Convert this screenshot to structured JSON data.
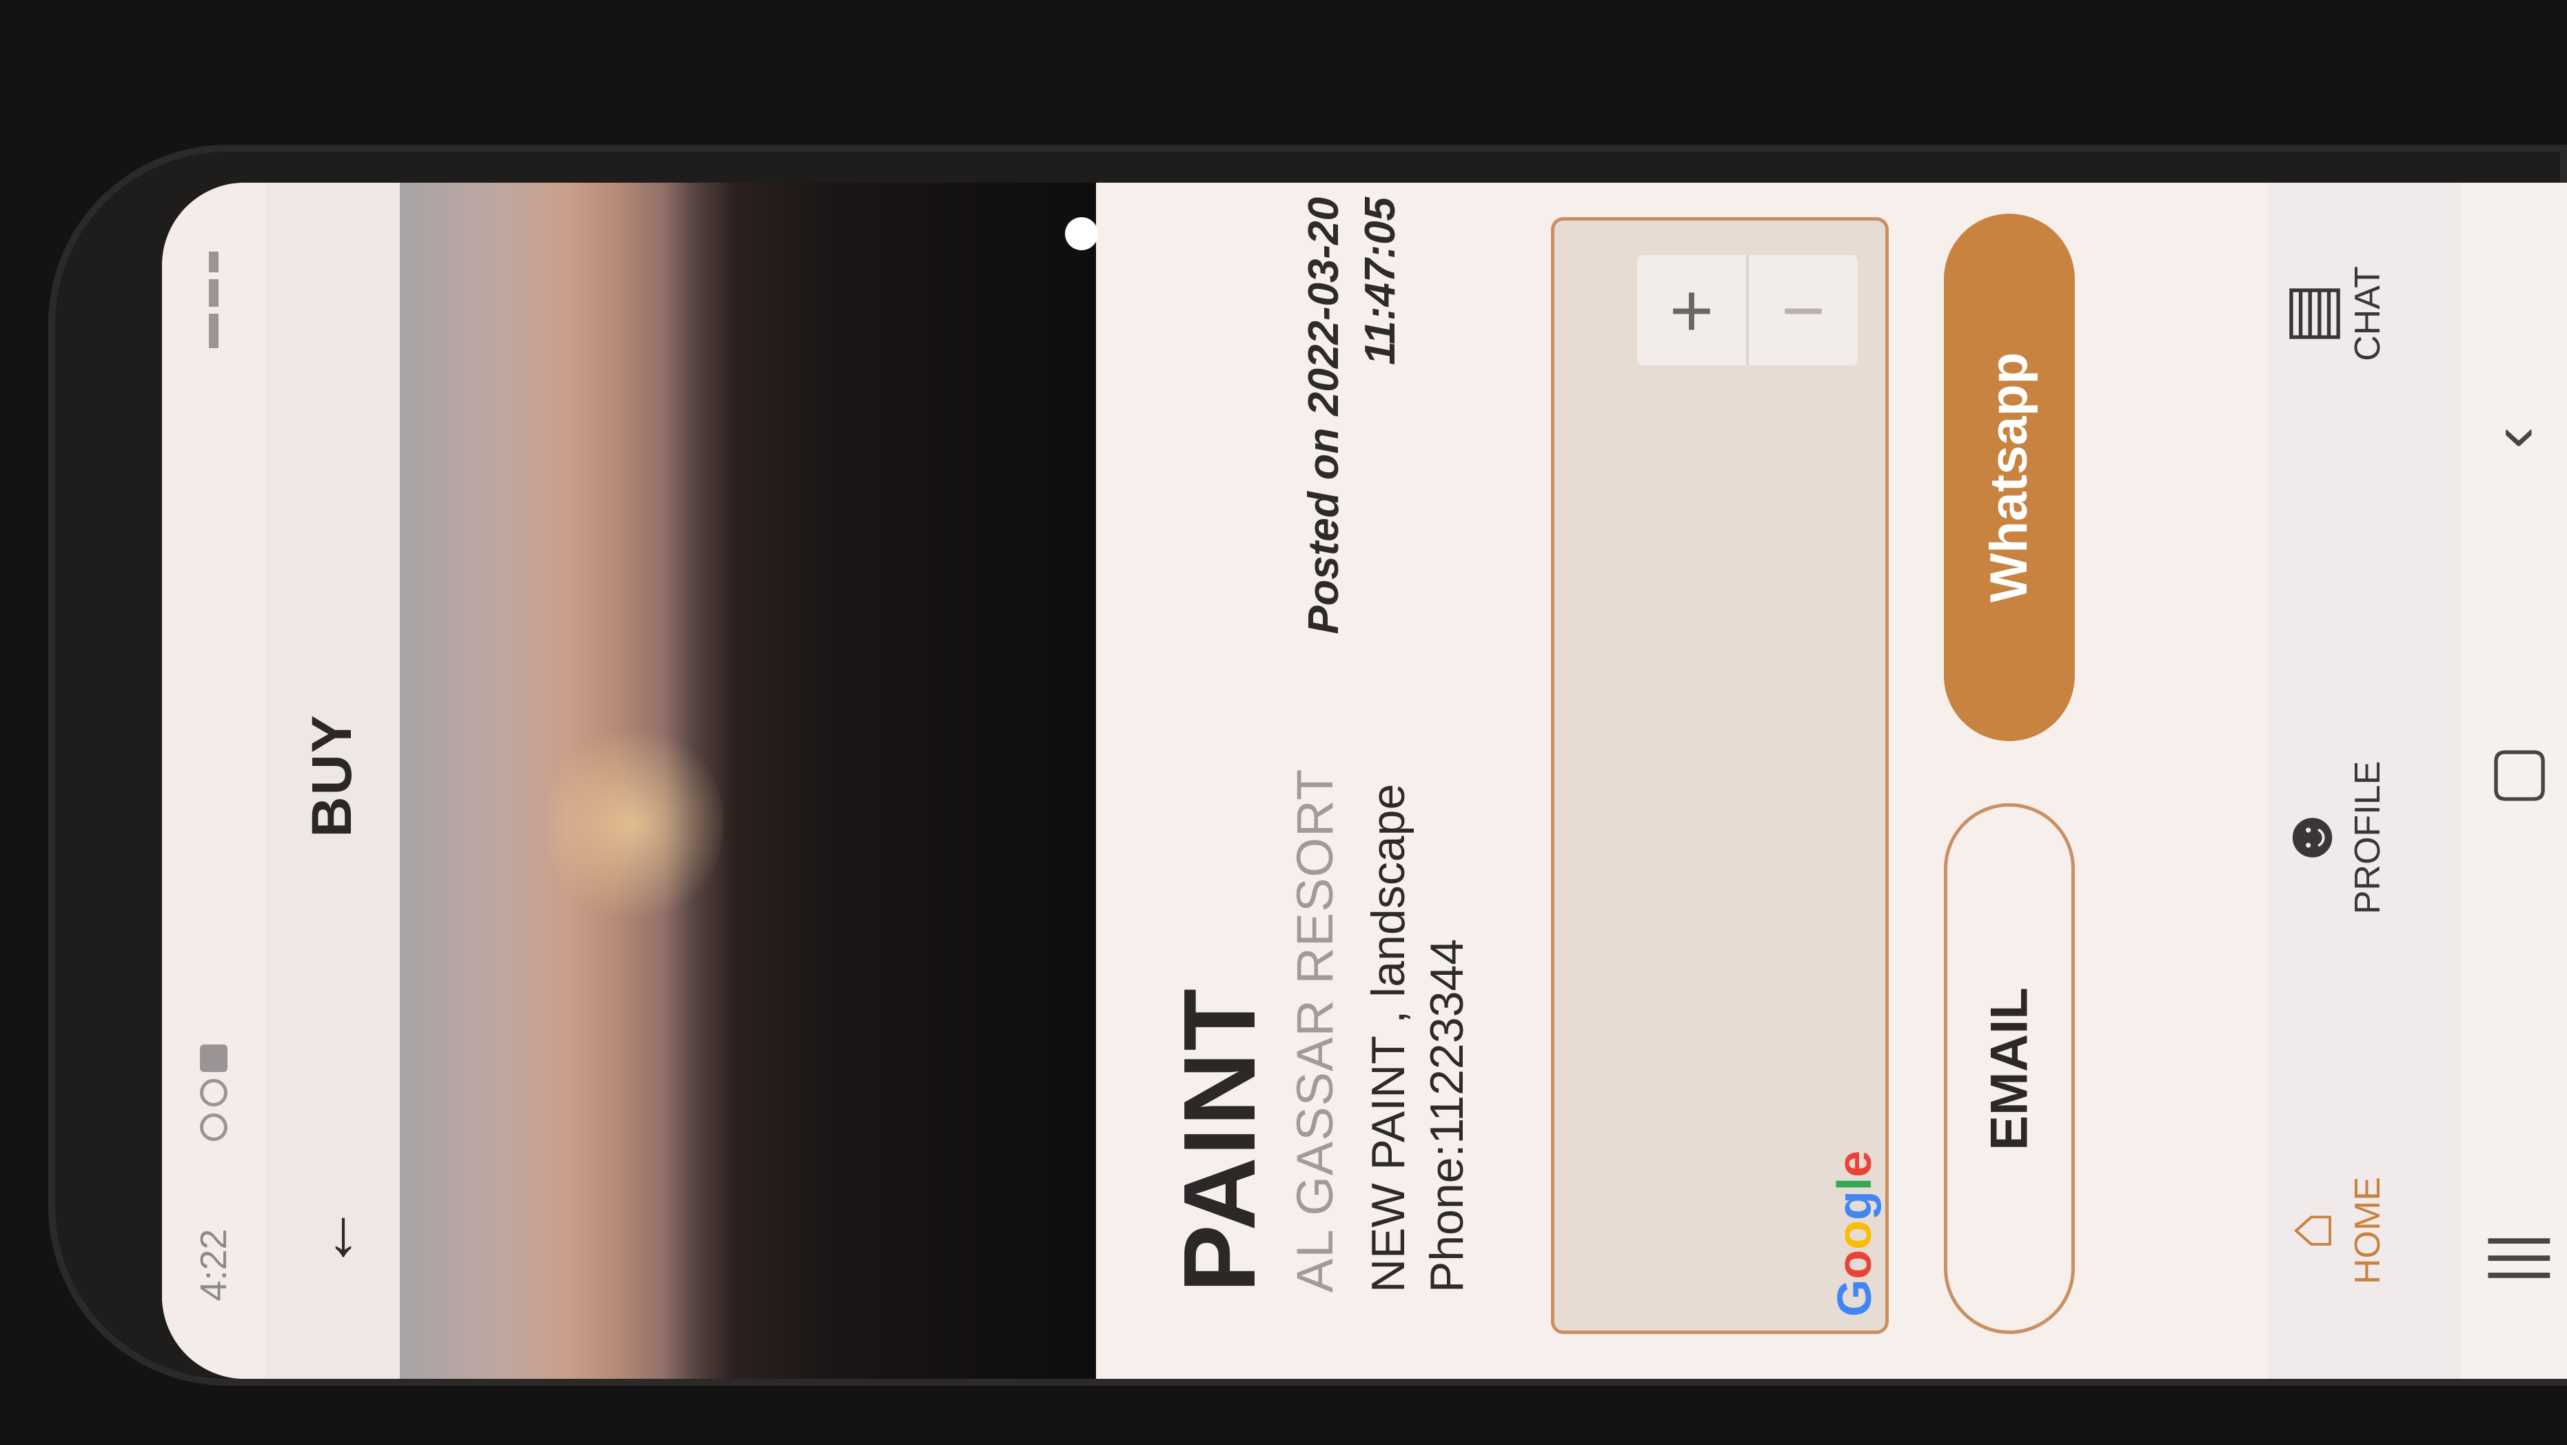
{
  "status_bar": {
    "time": "4:22"
  },
  "app_bar": {
    "back_icon": "arrow-left",
    "title": "BUY"
  },
  "listing": {
    "title": "PAINT",
    "location": "AL GASSAR RESORT",
    "description": "NEW PAINT , landscape",
    "phone": "Phone:11223344",
    "posted_line1": "Posted on 2022-03-20",
    "posted_line2": "11:47:05"
  },
  "map": {
    "zoom_in": "+",
    "zoom_out": "−",
    "attribution": "Google"
  },
  "actions": {
    "whatsapp": "Whatsapp",
    "email": "EMAIL"
  },
  "bottom_nav": {
    "home": "HOME",
    "profile": "PROFILE",
    "chat": "CHAT",
    "active": "home"
  },
  "colors": {
    "accent": "#c7833f",
    "background": "#f6efec",
    "text": "#2c2828"
  }
}
